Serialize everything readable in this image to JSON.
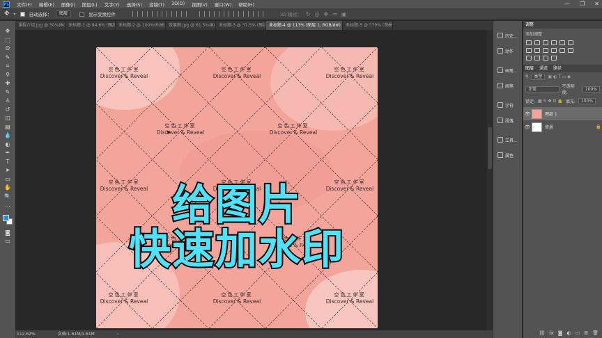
{
  "app": {
    "logo": "Ps"
  },
  "menu": [
    "文件(F)",
    "编辑(E)",
    "图像(I)",
    "图层(L)",
    "文字(Y)",
    "选择(S)",
    "滤镜(T)",
    "3D(D)",
    "视图(V)",
    "窗口(W)",
    "帮助(H)"
  ],
  "window_controls": [
    "—",
    "❐",
    "✕"
  ],
  "options": {
    "auto_select_label": "自动选择：",
    "auto_select_value": "图层",
    "show_transform_label": "显示变换控件",
    "mode_3d_label": "3D 模式："
  },
  "tabs": [
    {
      "label": "课程介绍.jpg @ 50%(RGB/...",
      "active": false
    },
    {
      "label": "未标题-1 @ 94.6% (图层 1...",
      "active": false
    },
    {
      "label": "未标题-2 @ 100%(RGB/8...",
      "active": false
    },
    {
      "label": "效果图.jpg @ 61.5%(RGB/...",
      "active": false
    },
    {
      "label": "未标题-3 @ 37.5% (形状 2...",
      "active": false
    },
    {
      "label": "未标题-4 @ 113% (图层 1, RGB/8#)",
      "active": true
    },
    {
      "label": "未标题-5 @ 379% (背景, R...",
      "active": false
    }
  ],
  "tools": [
    "move-icon",
    "marquee-icon",
    "lasso-icon",
    "quick-select-icon",
    "crop-icon",
    "eyedropper-icon",
    "healing-icon",
    "brush-icon",
    "stamp-icon",
    "history-brush-icon",
    "eraser-icon",
    "gradient-icon",
    "blur-icon",
    "dodge-icon",
    "pen-icon",
    "type-icon",
    "path-select-icon",
    "rectangle-icon",
    "hand-icon",
    "zoom-icon",
    "more-icon"
  ],
  "tool_glyphs": [
    "✥",
    "⬚",
    "ʘ",
    "✎",
    "⌗",
    "⚲",
    "✚",
    "✎",
    "♙",
    "↺",
    "◫",
    "▤",
    "💧",
    "◐",
    "✒",
    "T",
    "➤",
    "▭",
    "✋",
    "🔍",
    "…"
  ],
  "watermark": {
    "cn": "空色工作室",
    "en": "Discover & Reveal"
  },
  "headline": {
    "line1": "给图片",
    "line2": "快速加水印"
  },
  "status": {
    "zoom": "112.62%",
    "doc": "文档:1.61M/1.61M"
  },
  "mid_panel": [
    {
      "label": "历史...",
      "icon": "history-icon"
    },
    {
      "label": "动作",
      "icon": "actions-icon"
    },
    {
      "label": "画笔...",
      "icon": "brush-settings-icon"
    },
    {
      "label": "画笔",
      "icon": "brushes-icon"
    },
    {
      "label": "字符",
      "icon": "character-icon"
    },
    {
      "label": "段落",
      "icon": "paragraph-icon"
    },
    {
      "label": "工具...",
      "icon": "tool-presets-icon"
    },
    {
      "label": "属性",
      "icon": "properties-icon"
    }
  ],
  "right_panel": {
    "adjust_tab": "调整",
    "adjust_sub": "添加调整",
    "layer_tabs": [
      "图层",
      "通道",
      "路径"
    ],
    "kind": "类型",
    "blend": "正常",
    "opacity_label": "不透明度:",
    "opacity": "100%",
    "lock_label": "锁定:",
    "fill_label": "填充:",
    "fill": "100%",
    "layers": [
      {
        "name": "图层 1",
        "selected": true,
        "thumb": "#f3a59c"
      },
      {
        "name": "背景",
        "selected": false,
        "thumb": "#ffffff"
      }
    ]
  },
  "colors": {
    "canvas": "#f3a59c",
    "headline_fill": "#4ee3f8",
    "headline_stroke": "#0a0a0a",
    "foreground": "#2a8fd8"
  }
}
